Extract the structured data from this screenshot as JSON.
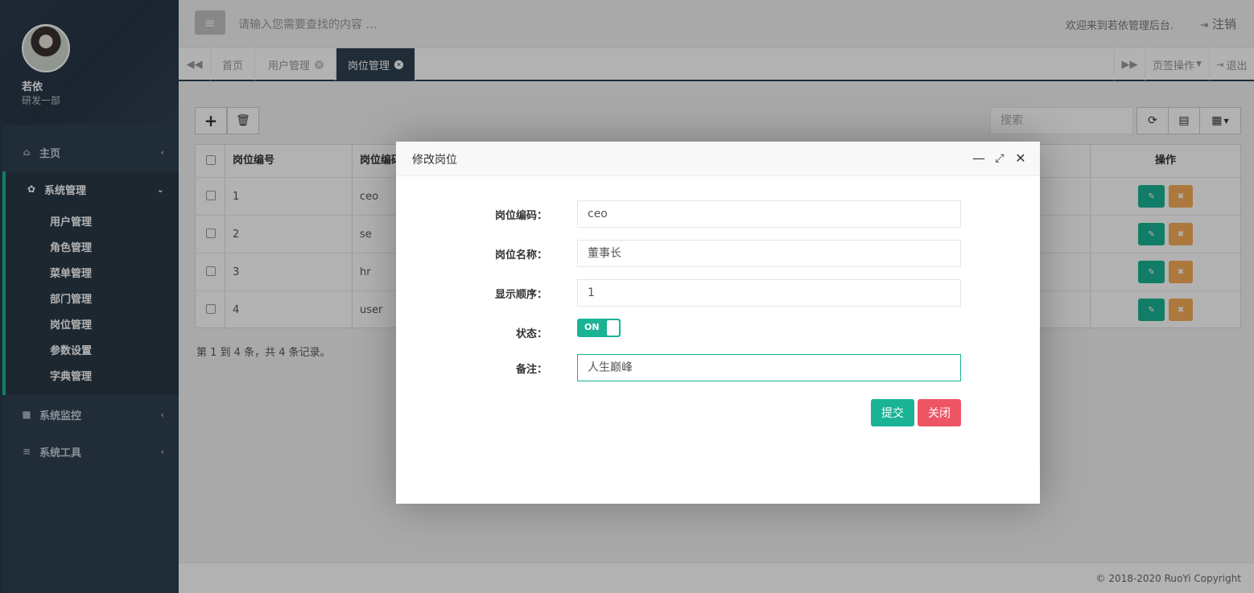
{
  "sidebar": {
    "user_name": "若依",
    "user_dept": "研发一部",
    "menu": [
      {
        "label": "主页",
        "icon": "home-icon"
      },
      {
        "label": "系统管理",
        "icon": "gear-icon"
      },
      {
        "label": "系统监控",
        "icon": "video-camera-icon"
      },
      {
        "label": "系统工具",
        "icon": "bars-icon"
      }
    ],
    "submenu": [
      "用户管理",
      "角色管理",
      "菜单管理",
      "部门管理",
      "岗位管理",
      "参数设置",
      "字典管理"
    ]
  },
  "topbar": {
    "search_placeholder": "请输入您需要查找的内容 …",
    "welcome": "欢迎来到若依管理后台.",
    "logout": "注销"
  },
  "tabs": {
    "items": [
      "首页",
      "用户管理",
      "岗位管理"
    ],
    "active": "岗位管理",
    "tab_ops": "页签操作",
    "exit": "退出"
  },
  "content": {
    "search_placeholder": "搜索",
    "table": {
      "headers": [
        "岗位编号",
        "岗位编码",
        "操作"
      ],
      "rows": [
        {
          "id": "1",
          "code": "ceo"
        },
        {
          "id": "2",
          "code": "se"
        },
        {
          "id": "3",
          "code": "hr"
        },
        {
          "id": "4",
          "code": "user"
        }
      ]
    },
    "pagination": "第 1 到 4 条，共 4 条记录。"
  },
  "footer": {
    "copyright": "© 2018-2020 RuoYi Copyright"
  },
  "modal": {
    "title": "修改岗位",
    "fields": {
      "code_label": "岗位编码：",
      "code_value": "ceo",
      "name_label": "岗位名称：",
      "name_value": "董事长",
      "order_label": "显示顺序：",
      "order_value": "1",
      "status_label": "状态：",
      "status_value": "ON",
      "remark_label": "备注：",
      "remark_value": "人生巅峰"
    },
    "submit": "提交",
    "close": "关闭"
  },
  "colors": {
    "primary": "#1ab394",
    "danger": "#ed5565",
    "warning": "#f8ac59",
    "sidebar": "#2f4050"
  }
}
